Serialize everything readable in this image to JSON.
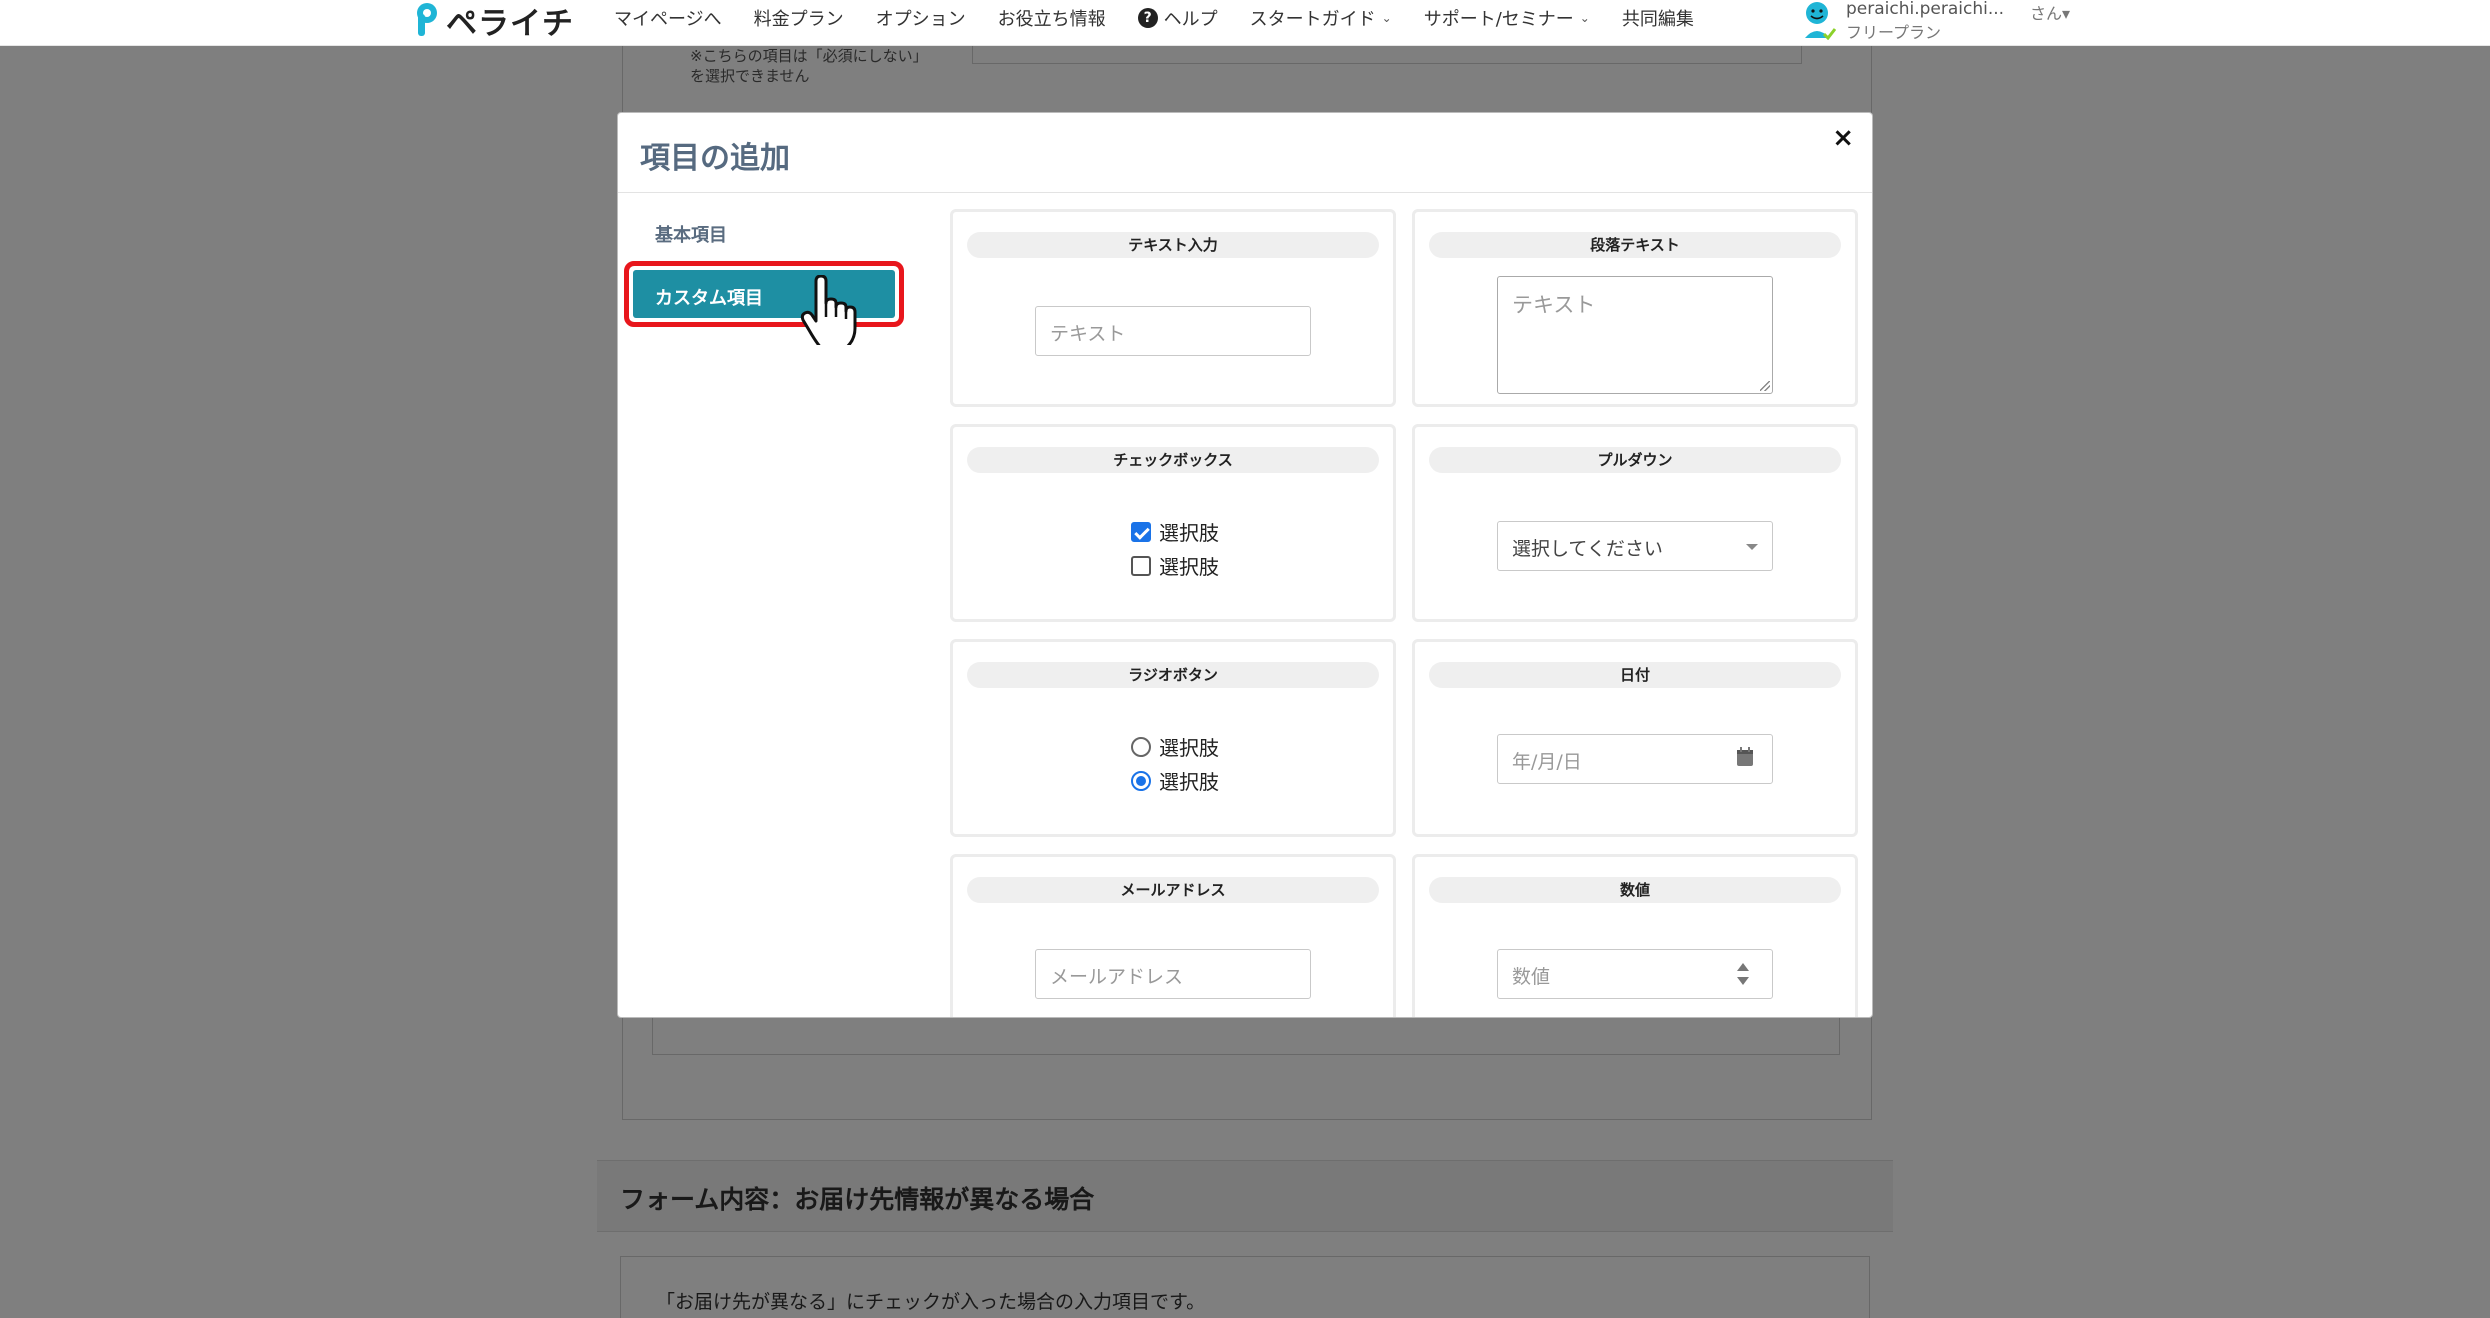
{
  "nav": {
    "logo": "ペライチ",
    "items": [
      {
        "label": "マイページへ"
      },
      {
        "label": "料金プラン"
      },
      {
        "label": "オプション"
      },
      {
        "label": "お役立ち情報"
      },
      {
        "label": "ヘルプ"
      },
      {
        "label": "スタートガイド"
      },
      {
        "label": "サポート/セミナー"
      },
      {
        "label": "共同編集"
      }
    ],
    "help_glyph": "?",
    "chevron": "⌄",
    "user_name": "peraichi.peraichi...",
    "user_plan": "フリープラン",
    "user_suffix": "さん▾"
  },
  "background": {
    "note_line1": "※こちらの項目は「必須にしない」",
    "note_line2": "を選択できません",
    "section_title": "フォーム内容：お届け先情報が異なる場合",
    "section_desc": "「お届け先が異なる」にチェックが入った場合の入力項目です。"
  },
  "modal": {
    "title": "項目の追加",
    "close": "×",
    "sidebar": {
      "basic": "基本項目",
      "custom": "カスタム項目"
    },
    "cards": {
      "text": {
        "title": "テキスト入力",
        "placeholder": "テキスト"
      },
      "paragraph": {
        "title": "段落テキスト",
        "placeholder": "テキスト"
      },
      "checkbox": {
        "title": "チェックボックス",
        "option1": "選択肢",
        "option2": "選択肢",
        "option1_checked": true,
        "option2_checked": false
      },
      "dropdown": {
        "title": "プルダウン",
        "value": "選択してください"
      },
      "radio": {
        "title": "ラジオボタン",
        "option1": "選択肢",
        "option2": "選択肢",
        "selected": 2
      },
      "date": {
        "title": "日付",
        "placeholder": "年/月/日"
      },
      "email": {
        "title": "メールアドレス",
        "placeholder": "メールアドレス"
      },
      "number": {
        "title": "数値",
        "placeholder": "数値"
      }
    }
  },
  "colors": {
    "accent": "#1e8fa3",
    "highlight": "#e8161c",
    "brand": "#1fb5d6",
    "title": "#566a80"
  }
}
